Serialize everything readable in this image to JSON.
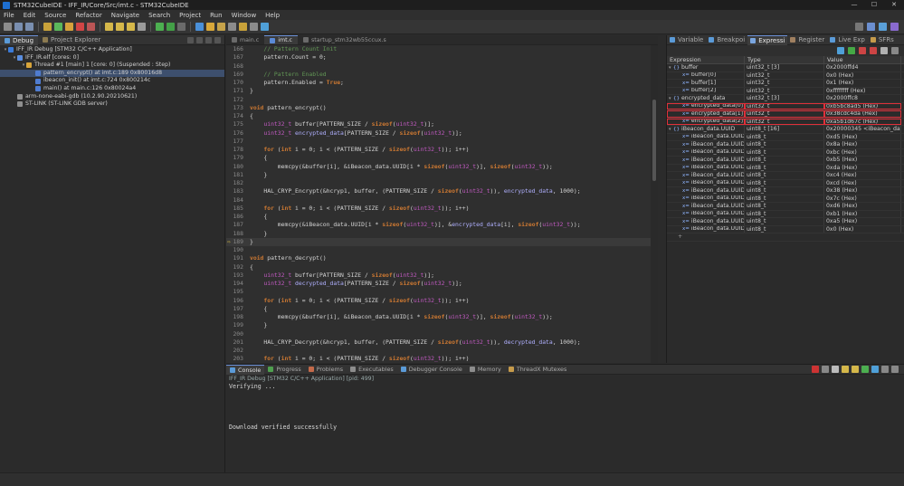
{
  "window": {
    "title": "STM32CubeIDE - IFF_IR/Core/Src/imt.c - STM32CubeIDE",
    "controls": [
      "—",
      "☐",
      "✕"
    ]
  },
  "menu": [
    "File",
    "Edit",
    "Source",
    "Refactor",
    "Navigate",
    "Search",
    "Project",
    "Run",
    "Window",
    "Help"
  ],
  "left_panel": {
    "tabs": [
      "Debug",
      "Project Explorer"
    ],
    "tree": [
      {
        "indent": 0,
        "toggle": "▾",
        "icon": "debug-config-icon",
        "color": "#3b7bd8",
        "text": "IFF_IR Debug [STM32 C/C++ Application]"
      },
      {
        "indent": 1,
        "toggle": "▾",
        "icon": "elf-icon",
        "color": "#5a8ee0",
        "text": "IFF_IR.elf [cores: 0]"
      },
      {
        "indent": 2,
        "toggle": "▾",
        "icon": "thread-icon",
        "color": "#d9a53a",
        "text": "Thread #1 [main] 1 [core: 0] (Suspended : Step)"
      },
      {
        "indent": 3,
        "toggle": "",
        "icon": "stack-frame-icon",
        "color": "#4f7cd0",
        "text": "pattern_encrypt() at imt.c:189 0x80016d8",
        "selected": true
      },
      {
        "indent": 3,
        "toggle": "",
        "icon": "stack-frame-icon",
        "color": "#4f7cd0",
        "text": "ibeacon_init() at imt.c:724 0x800214c"
      },
      {
        "indent": 3,
        "toggle": "",
        "icon": "stack-frame-icon",
        "color": "#4f7cd0",
        "text": "main() at main.c:126 0x80024a4"
      },
      {
        "indent": 1,
        "toggle": "",
        "icon": "process-icon",
        "color": "#8f8f8f",
        "text": "arm-none-eabi-gdb (10.2.90.20210621)"
      },
      {
        "indent": 1,
        "toggle": "",
        "icon": "process-icon",
        "color": "#8f8f8f",
        "text": "ST-LINK (ST-LINK GDB server)"
      }
    ]
  },
  "editor": {
    "tabs": [
      {
        "label": "main.c",
        "active": false
      },
      {
        "label": "imt.c",
        "active": true
      },
      {
        "label": "startup_stm32wb55ccux.s",
        "active": false
      }
    ],
    "lines": [
      {
        "n": "166",
        "code": "    // Pattern Count Init"
      },
      {
        "n": "167",
        "code": "    pattern.Count = 0;"
      },
      {
        "n": "168",
        "code": ""
      },
      {
        "n": "169",
        "code": "    // Pattern Enabled"
      },
      {
        "n": "170",
        "code": "    pattern.Enabled = True;"
      },
      {
        "n": "171",
        "code": "}"
      },
      {
        "n": "172",
        "code": ""
      },
      {
        "n": "173",
        "code": "void pattern_encrypt()"
      },
      {
        "n": "174",
        "code": "{"
      },
      {
        "n": "175",
        "code": "    uint32_t buffer[PATTERN_SIZE / sizeof(uint32_t)];"
      },
      {
        "n": "176",
        "code": "    uint32_t encrypted_data[PATTERN_SIZE / sizeof(uint32_t)];"
      },
      {
        "n": "177",
        "code": ""
      },
      {
        "n": "178",
        "code": "    for (int i = 0; i < (PATTERN_SIZE / sizeof(uint32_t)); i++)"
      },
      {
        "n": "179",
        "code": "    {"
      },
      {
        "n": "180",
        "code": "        memcpy(&buffer[i], &iBeacon_data.UUID[i * sizeof(uint32_t)], sizeof(uint32_t));"
      },
      {
        "n": "181",
        "code": "    }"
      },
      {
        "n": "182",
        "code": ""
      },
      {
        "n": "183",
        "code": "    HAL_CRYP_Encrypt(&hcryp1, buffer, (PATTERN_SIZE / sizeof(uint32_t)), encrypted_data, 1000);"
      },
      {
        "n": "184",
        "code": ""
      },
      {
        "n": "185",
        "code": "    for (int i = 0; i < (PATTERN_SIZE / sizeof(uint32_t)); i++)"
      },
      {
        "n": "186",
        "code": "    {"
      },
      {
        "n": "187",
        "code": "        memcpy(&iBeacon_data.UUID[i * sizeof(uint32_t)], &encrypted_data[i], sizeof(uint32_t));"
      },
      {
        "n": "188",
        "code": "    }"
      },
      {
        "n": "189",
        "code": "}",
        "current": true
      },
      {
        "n": "190",
        "code": ""
      },
      {
        "n": "191",
        "code": "void pattern_decrypt()"
      },
      {
        "n": "192",
        "code": "{"
      },
      {
        "n": "193",
        "code": "    uint32_t buffer[PATTERN_SIZE / sizeof(uint32_t)];"
      },
      {
        "n": "194",
        "code": "    uint32_t decrypted_data[PATTERN_SIZE / sizeof(uint32_t)];"
      },
      {
        "n": "195",
        "code": ""
      },
      {
        "n": "196",
        "code": "    for (int i = 0; i < (PATTERN_SIZE / sizeof(uint32_t)); i++)"
      },
      {
        "n": "197",
        "code": "    {"
      },
      {
        "n": "198",
        "code": "        memcpy(&buffer[i], &iBeacon_data.UUID[i * sizeof(uint32_t)], sizeof(uint32_t));"
      },
      {
        "n": "199",
        "code": "    }"
      },
      {
        "n": "200",
        "code": ""
      },
      {
        "n": "201",
        "code": "    HAL_CRYP_Decrypt(&hcryp1, buffer, (PATTERN_SIZE / sizeof(uint32_t)), decrypted_data, 1000);"
      },
      {
        "n": "202",
        "code": ""
      },
      {
        "n": "203",
        "code": "    for (int i = 0; i < (PATTERN_SIZE / sizeof(uint32_t)); i++)"
      },
      {
        "n": "204",
        "code": "    {"
      }
    ]
  },
  "right_panel": {
    "tabs": [
      "Variable",
      "Breakpoi",
      "Expressi",
      "Register",
      "Live Exp",
      "SFRs"
    ],
    "active_tab": "Expressi",
    "columns": [
      "Expression",
      "Type",
      "Value"
    ],
    "rows": [
      {
        "level": 0,
        "toggle": "▾",
        "icon": "{}",
        "name": "buffer",
        "type": "uint32_t [3]",
        "value": "0x2000ffd4"
      },
      {
        "level": 1,
        "toggle": "",
        "icon": "x=",
        "name": "buffer[0]",
        "type": "uint32_t",
        "value": "0x0 (Hex)"
      },
      {
        "level": 1,
        "toggle": "",
        "icon": "x=",
        "name": "buffer[1]",
        "type": "uint32_t",
        "value": "0x1 (Hex)"
      },
      {
        "level": 1,
        "toggle": "",
        "icon": "x=",
        "name": "buffer[2]",
        "type": "uint32_t",
        "value": "0xffffffff (Hex)"
      },
      {
        "level": 0,
        "toggle": "▾",
        "icon": "{}",
        "name": "encrypted_data",
        "type": "uint32_t [3]",
        "value": "0x2000ffc8"
      },
      {
        "level": 1,
        "toggle": "",
        "icon": "x=",
        "name": "encrypted_data[0]",
        "type": "uint32_t",
        "value": "0xb5bc8ad5 (Hex)",
        "boxed": true
      },
      {
        "level": 1,
        "toggle": "",
        "icon": "x=",
        "name": "encrypted_data[1]",
        "type": "uint32_t",
        "value": "0x38cdc4da (Hex)",
        "boxed": true
      },
      {
        "level": 1,
        "toggle": "",
        "icon": "x=",
        "name": "encrypted_data[2]",
        "type": "uint32_t",
        "value": "0xa5b1d67c (Hex)",
        "boxed": true
      },
      {
        "level": 0,
        "toggle": "▾",
        "icon": "{}",
        "name": "iBeacon_data.UUID",
        "type": "uint8_t [16]",
        "value": "0x20000345 <iBeacon_dat"
      },
      {
        "level": 1,
        "toggle": "",
        "icon": "x=",
        "name": "iBeacon_data.UUID[",
        "type": "uint8_t",
        "value": "0xd5 (Hex)"
      },
      {
        "level": 1,
        "toggle": "",
        "icon": "x=",
        "name": "iBeacon_data.UUID[",
        "type": "uint8_t",
        "value": "0x8a (Hex)"
      },
      {
        "level": 1,
        "toggle": "",
        "icon": "x=",
        "name": "iBeacon_data.UUID[",
        "type": "uint8_t",
        "value": "0xbc (Hex)"
      },
      {
        "level": 1,
        "toggle": "",
        "icon": "x=",
        "name": "iBeacon_data.UUID[",
        "type": "uint8_t",
        "value": "0xb5 (Hex)"
      },
      {
        "level": 1,
        "toggle": "",
        "icon": "x=",
        "name": "iBeacon_data.UUID[",
        "type": "uint8_t",
        "value": "0xda (Hex)"
      },
      {
        "level": 1,
        "toggle": "",
        "icon": "x=",
        "name": "iBeacon_data.UUID[",
        "type": "uint8_t",
        "value": "0xc4 (Hex)"
      },
      {
        "level": 1,
        "toggle": "",
        "icon": "x=",
        "name": "iBeacon_data.UUID[",
        "type": "uint8_t",
        "value": "0xcd (Hex)"
      },
      {
        "level": 1,
        "toggle": "",
        "icon": "x=",
        "name": "iBeacon_data.UUID[",
        "type": "uint8_t",
        "value": "0x38 (Hex)"
      },
      {
        "level": 1,
        "toggle": "",
        "icon": "x=",
        "name": "iBeacon_data.UUID[",
        "type": "uint8_t",
        "value": "0x7c (Hex)"
      },
      {
        "level": 1,
        "toggle": "",
        "icon": "x=",
        "name": "iBeacon_data.UUID[",
        "type": "uint8_t",
        "value": "0xd6 (Hex)"
      },
      {
        "level": 1,
        "toggle": "",
        "icon": "x=",
        "name": "iBeacon_data.UUID[",
        "type": "uint8_t",
        "value": "0xb1 (Hex)"
      },
      {
        "level": 1,
        "toggle": "",
        "icon": "x=",
        "name": "iBeacon_data.UUID[",
        "type": "uint8_t",
        "value": "0xa5 (Hex)"
      },
      {
        "level": 1,
        "toggle": "",
        "icon": "x=",
        "name": "iBeacon_data.UUID[",
        "type": "uint8_t",
        "value": "0x0 (Hex)"
      }
    ],
    "add_label": "+"
  },
  "console": {
    "tabs": [
      "Console",
      "Progress",
      "Problems",
      "Executables",
      "Debugger Console",
      "Memory",
      "ThreadX Mutexes"
    ],
    "description": "IFF_IR Debug [STM32 C/C++ Application]  [pid: 499]",
    "output": [
      "Verifying ...",
      "",
      "",
      "",
      "",
      "Download verified successfully"
    ]
  },
  "colors": {
    "accent": "#6a8fd6",
    "highlight_box": "#e0303a",
    "selection": "#3d4f6d"
  }
}
